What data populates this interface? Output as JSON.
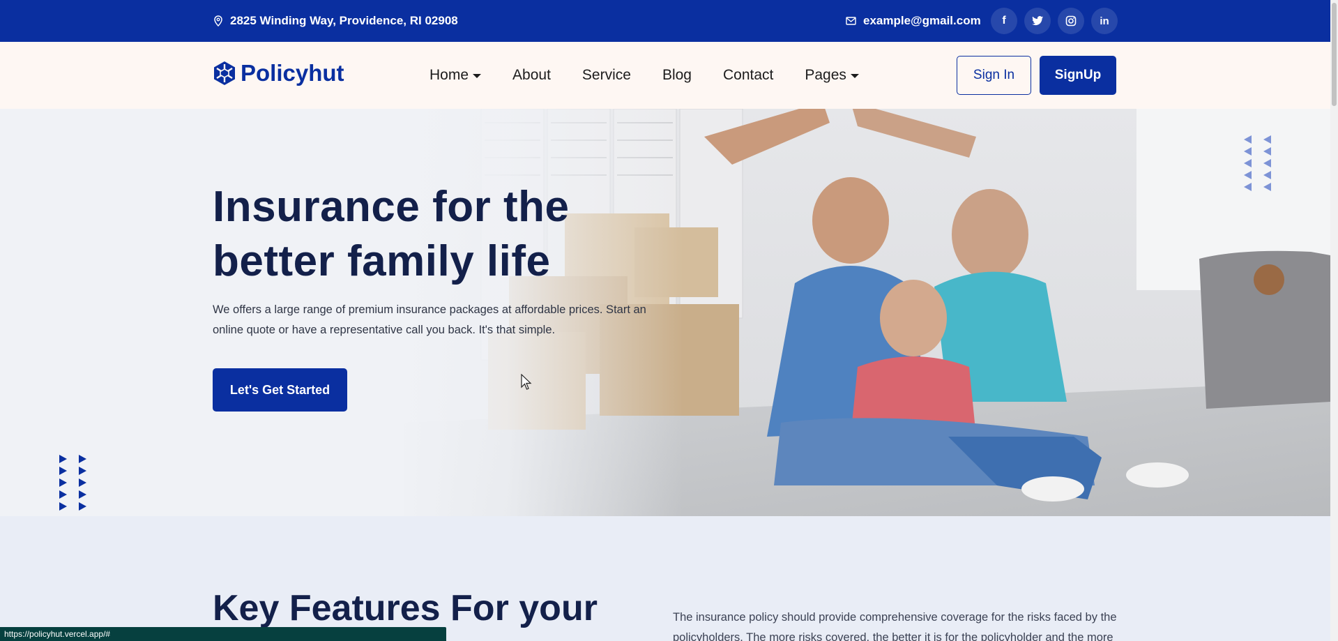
{
  "topbar": {
    "address": "2825 Winding Way, Providence, RI 02908",
    "email": "example@gmail.com",
    "socials": [
      {
        "icon": "facebook-icon",
        "glyph": "f"
      },
      {
        "icon": "twitter-icon",
        "glyph": "t"
      },
      {
        "icon": "instagram-icon",
        "glyph": "◎"
      },
      {
        "icon": "linkedin-icon",
        "glyph": "in"
      }
    ]
  },
  "nav": {
    "brand": "Policyhut",
    "items": [
      {
        "label": "Home",
        "dropdown": true
      },
      {
        "label": "About",
        "dropdown": false
      },
      {
        "label": "Service",
        "dropdown": false
      },
      {
        "label": "Blog",
        "dropdown": false
      },
      {
        "label": "Contact",
        "dropdown": false
      },
      {
        "label": "Pages",
        "dropdown": true
      }
    ],
    "signin": "Sign In",
    "signup": "SignUp"
  },
  "hero": {
    "title": "Insurance for the better family life",
    "subtitle": "We offers a large range of premium insurance packages at affordable prices. Start an online quote or have a representative call you back. It's that simple.",
    "cta": "Let's Get Started"
  },
  "features": {
    "title": "Key Features For your",
    "text": "The insurance policy should provide comprehensive coverage for the risks faced by the policyholders. The more risks covered, the better it is for the policyholder and the more"
  },
  "statusbar": {
    "url": "https://policyhut.vercel.app/#"
  },
  "colors": {
    "primary": "#0a2fa0",
    "heading": "#13204a",
    "nav_bg": "#fef7f3",
    "hero_bg": "#f0f2f6",
    "features_bg": "#e9edf6"
  }
}
